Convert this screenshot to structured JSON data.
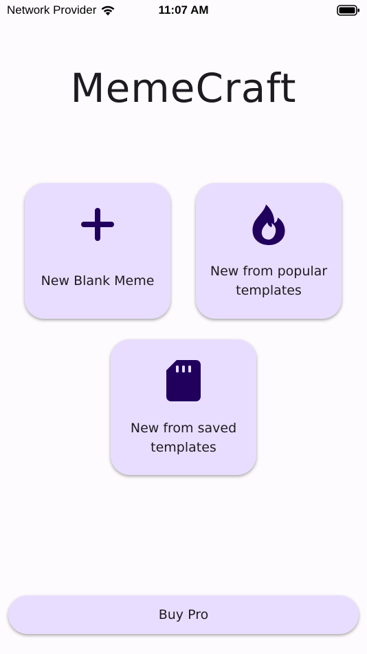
{
  "status_bar": {
    "carrier": "Network Provider",
    "time": "11:07 AM",
    "wifi_icon": "wifi-icon",
    "battery_icon": "battery-full-icon"
  },
  "app": {
    "title": "MemeCraft"
  },
  "actions": [
    {
      "label": "New Blank Meme",
      "icon": "plus-icon"
    },
    {
      "label": "New from popular templates",
      "icon": "flame-icon"
    },
    {
      "label": "New from saved templates",
      "icon": "sd-card-icon"
    }
  ],
  "footer": {
    "buy_pro_label": "Buy Pro"
  },
  "colors": {
    "card_bg": "#e9ddff",
    "icon": "#21005d",
    "text": "#1d1b20",
    "background": "#fdfbfd"
  }
}
